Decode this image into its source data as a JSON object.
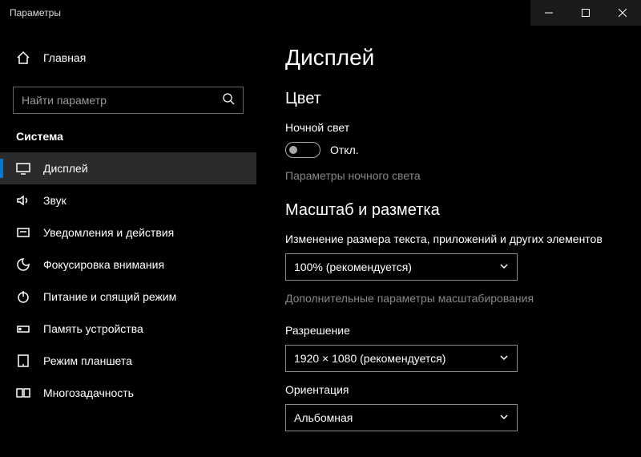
{
  "window": {
    "title": "Параметры"
  },
  "sidebar": {
    "home": "Главная",
    "search_placeholder": "Найти параметр",
    "category": "Система",
    "items": [
      {
        "label": "Дисплей"
      },
      {
        "label": "Звук"
      },
      {
        "label": "Уведомления и действия"
      },
      {
        "label": "Фокусировка внимания"
      },
      {
        "label": "Питание и спящий режим"
      },
      {
        "label": "Память устройства"
      },
      {
        "label": "Режим планшета"
      },
      {
        "label": "Многозадачность"
      }
    ]
  },
  "main": {
    "title": "Дисплей",
    "color_section": "Цвет",
    "night_light_label": "Ночной свет",
    "night_light_state": "Откл.",
    "night_light_settings": "Параметры ночного света",
    "scale_section": "Масштаб и разметка",
    "scale_label": "Изменение размера текста, приложений и других элементов",
    "scale_value": "100% (рекомендуется)",
    "advanced_scaling": "Дополнительные параметры масштабирования",
    "resolution_label": "Разрешение",
    "resolution_value": "1920 × 1080 (рекомендуется)",
    "orientation_label": "Ориентация",
    "orientation_value": "Альбомная"
  }
}
